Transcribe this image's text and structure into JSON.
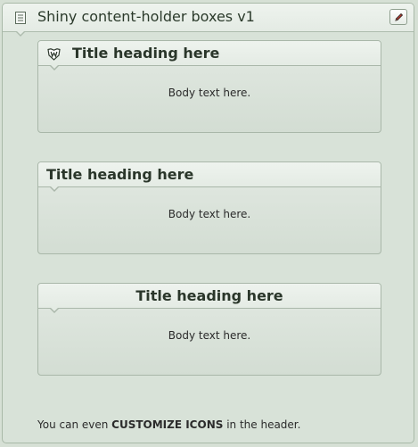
{
  "panel": {
    "title": "Shiny content-holder boxes v1",
    "header_icon": "document-icon",
    "edit_icon": "pencil-icon"
  },
  "boxes": [
    {
      "title": "Title heading here",
      "body": "Body text here.",
      "icon": "badge-icon",
      "title_align": "left-with-icon"
    },
    {
      "title": "Title heading here",
      "body": "Body text here.",
      "title_align": "left"
    },
    {
      "title": "Title heading here",
      "body": "Body text here.",
      "title_align": "center"
    }
  ],
  "footer": {
    "prefix": "You can even ",
    "emphasis": "CUSTOMIZE ICONS",
    "suffix": " in the header."
  },
  "colors": {
    "background": "#d6e0d5",
    "header_bg": "#e8efe8",
    "border": "#a9b7a9",
    "text": "#2a362a"
  }
}
